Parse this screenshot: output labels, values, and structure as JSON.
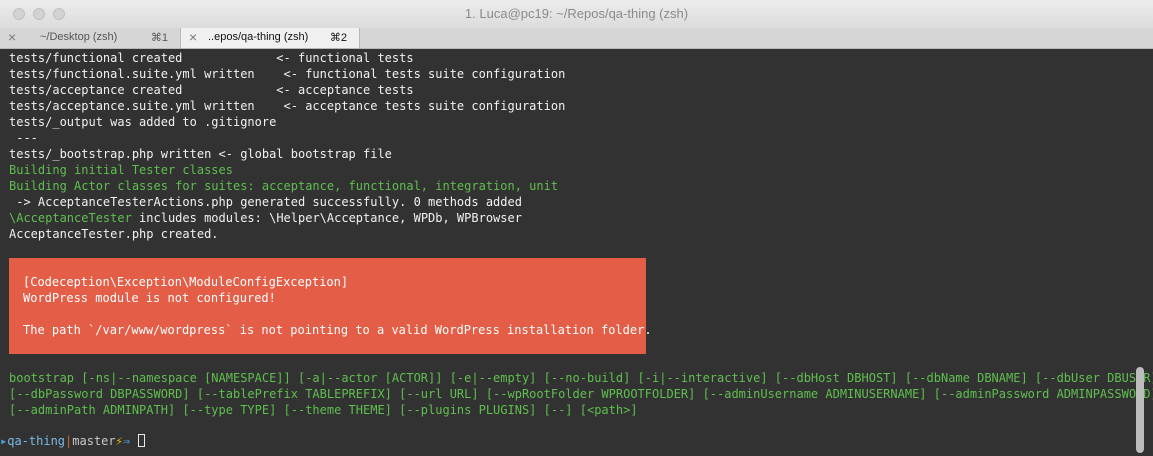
{
  "window": {
    "title": "1. Luca@pc19: ~/Repos/qa-thing (zsh)"
  },
  "tabs": [
    {
      "label": "~/Desktop (zsh)",
      "shortcut": "⌘1",
      "active": false
    },
    {
      "label": "..epos/qa-thing (zsh)",
      "shortcut": "⌘2",
      "active": true
    }
  ],
  "terminal": {
    "lines": [
      "tests/functional created             <- functional tests",
      "tests/functional.suite.yml written    <- functional tests suite configuration",
      "tests/acceptance created             <- acceptance tests",
      "tests/acceptance.suite.yml written    <- acceptance tests suite configuration",
      "tests/_output was added to .gitignore",
      " ---",
      "tests/_bootstrap.php written <- global bootstrap file"
    ],
    "green_lines": [
      "Building initial Tester classes",
      "Building Actor classes for suites: acceptance, functional, integration, unit"
    ],
    "actions_line": " -> AcceptanceTesterActions.php generated successfully. 0 methods added",
    "includes_class": "\\AcceptanceTester",
    "includes_rest": " includes modules: \\Helper\\Acceptance, WPDb, WPBrowser",
    "created_line": "AcceptanceTester.php created.",
    "error": {
      "exception": "[Codeception\\Exception\\ModuleConfigException]",
      "message": "WordPress module is not configured!",
      "detail": "The path `/var/www/wordpress` is not pointing to a valid WordPress installation folder."
    },
    "usage_lines": [
      "bootstrap [-ns|--namespace [NAMESPACE]] [-a|--actor [ACTOR]] [-e|--empty] [--no-build] [-i|--interactive] [--dbHost DBHOST] [--dbName DBNAME] [--dbUser DBUSER]",
      "[--dbPassword DBPASSWORD] [--tablePrefix TABLEPREFIX] [--url URL] [--wpRootFolder WPROOTFOLDER] [--adminUsername ADMINUSERNAME] [--adminPassword ADMINPASSWORD]",
      "[--adminPath ADMINPATH] [--type TYPE] [--theme THEME] [--plugins PLUGINS] [--] [<path>]"
    ],
    "prompt": {
      "marker": "▸",
      "dir": "qa-thing",
      "separator": "|",
      "branch": "master",
      "bolt": "⚡",
      "arrow": "⇒"
    }
  }
}
